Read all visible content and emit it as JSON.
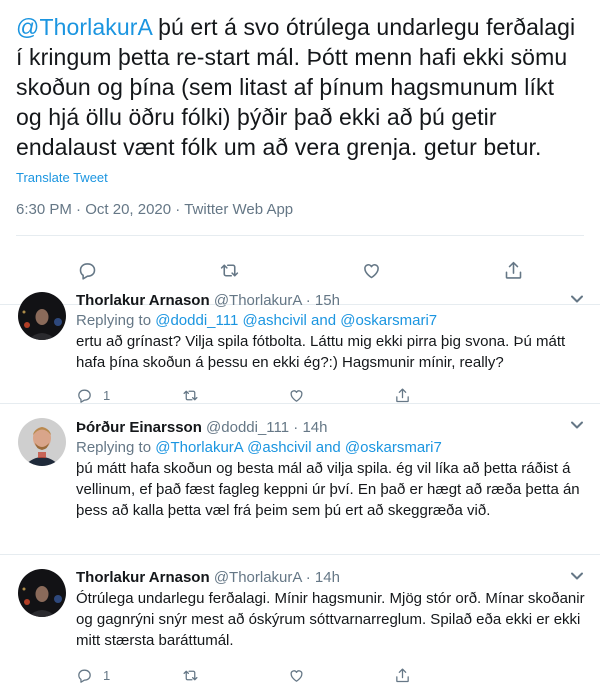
{
  "main_tweet": {
    "mention": "@ThorlakurA",
    "text": " þú ert á svo ótrúlega undarlegu ferðalagi í kringum þetta re-start mál. Þótt menn hafi ekki sömu skoðun og þína (sem litast af þínum hagsmunum líkt og hjá öllu öðru fólki) þýðir það ekki að þú getir endalaust vænt fólk um að vera grenja. getur betur.",
    "translate_label": "Translate Tweet",
    "time": "6:30 PM",
    "date": "Oct 20, 2020",
    "source": "Twitter Web App",
    "sep": " · "
  },
  "replies": [
    {
      "name": "Thorlakur Arnason",
      "handle": "@ThorlakurA",
      "dot": " · ",
      "time": "15h",
      "replying_prefix": "Replying to ",
      "replying_users": "@doddi_111 @ashcivil and @oskarsmari7",
      "text": "ertu að grínast? Vilja spila fótbolta. Láttu mig ekki pirra þig svona. Þú mátt hafa þína skoðun á þessu en ekki ég?:) Hagsmunir mínir, really?",
      "reply_count": "1"
    },
    {
      "name": "Þórður Einarsson",
      "handle": "@doddi_111",
      "dot": " · ",
      "time": "14h",
      "replying_prefix": "Replying to ",
      "replying_users": "@ThorlakurA @ashcivil and @oskarsmari7",
      "text": "þú mátt hafa skoðun og besta mál að vilja spila. ég vil líka að þetta ráðist á vellinum, ef það fæst fagleg keppni úr því. En það er hægt að ræða þetta án þess að kalla þetta væl frá þeim sem þú ert að skeggræða við.",
      "reply_count": "1"
    },
    {
      "name": "Thorlakur Arnason",
      "handle": "@ThorlakurA",
      "dot": " · ",
      "time": "14h",
      "text": "Ótrúlega undarlegu ferðalagi. Mínir hagsmunir. Mjög stór orð. Mínar skoðanir og gagnrýni snýr mest að óskýrum sóttvarnarreglum. Spilað eða ekki er ekki mitt stærsta baráttumál.",
      "reply_count": "1"
    }
  ],
  "colors": {
    "accent": "#1b95e0",
    "secondary_text": "#657786",
    "divider": "#e6ecf0"
  }
}
